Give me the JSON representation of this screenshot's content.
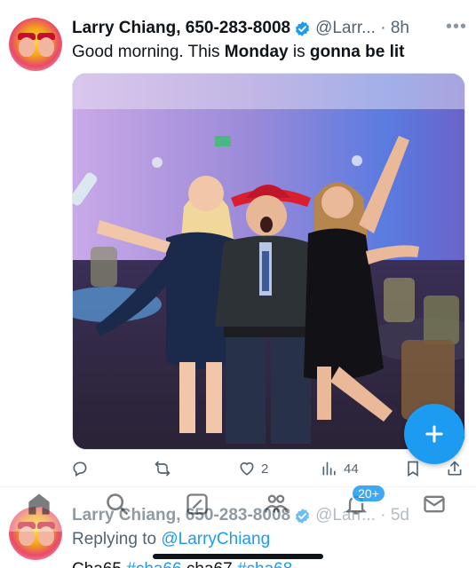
{
  "tweet": {
    "author_name": "Larry Chiang, 650-283-8008",
    "handle_time": "@Larr... · 8h",
    "more_icon": "more-horizontal-icon",
    "text_parts": {
      "t1": "Good morning. This ",
      "b1": "Monday",
      "t2": " is ",
      "b2": "gonna be lit"
    },
    "actions": {
      "reply": {
        "icon": "reply-icon",
        "count": ""
      },
      "retweet": {
        "icon": "retweet-icon",
        "count": ""
      },
      "like": {
        "icon": "heart-icon",
        "count": "2"
      },
      "views": {
        "icon": "views-icon",
        "count": "44"
      },
      "bookmark": {
        "icon": "bookmark-icon",
        "count": ""
      },
      "share": {
        "icon": "share-icon",
        "count": ""
      }
    }
  },
  "compose": {
    "icon": "plus-icon"
  },
  "tweet2": {
    "author_name": "Larry Chiang, 650-283-8008",
    "handle_time": "@Larr... · 5d",
    "reply_prefix": "Replying to ",
    "reply_to": "@LarryChiang",
    "tags": {
      "t1": "Cha65 ",
      "h1": "#cha66",
      "t2": " cha67 ",
      "h2": "#cha68"
    }
  },
  "tabbar": {
    "home": "home-icon",
    "search": "search-icon",
    "communities": "communities-icon",
    "people": "people-icon",
    "notifications": "bell-icon",
    "messages": "mail-icon",
    "notification_badge": "20+"
  },
  "colors": {
    "accent": "#1d9bf0",
    "text": "#0f1419",
    "muted": "#536471"
  }
}
